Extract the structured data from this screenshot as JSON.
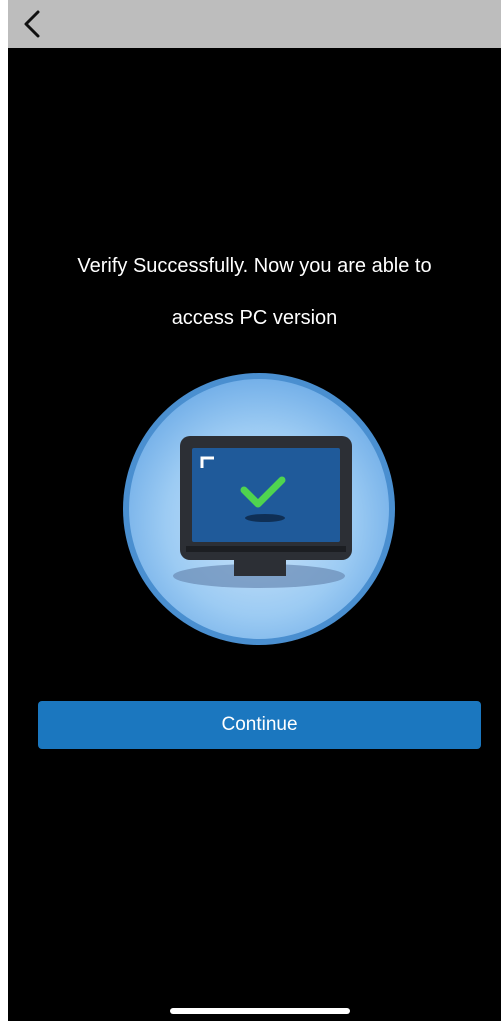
{
  "header": {
    "back_icon": "chevron-left-icon"
  },
  "message": {
    "line1": "Verify Successfully. Now you are able to",
    "line2": "access PC version"
  },
  "illustration": {
    "icon": "monitor-checkmark-icon",
    "colors": {
      "circle_fill": "#8ec5f2",
      "circle_border": "#4a8fd0",
      "screen": "#1f5a9a",
      "bezel": "#2c2f35",
      "check": "#4fd44f"
    }
  },
  "actions": {
    "continue_label": "Continue",
    "accent_color": "#1b77bf"
  }
}
